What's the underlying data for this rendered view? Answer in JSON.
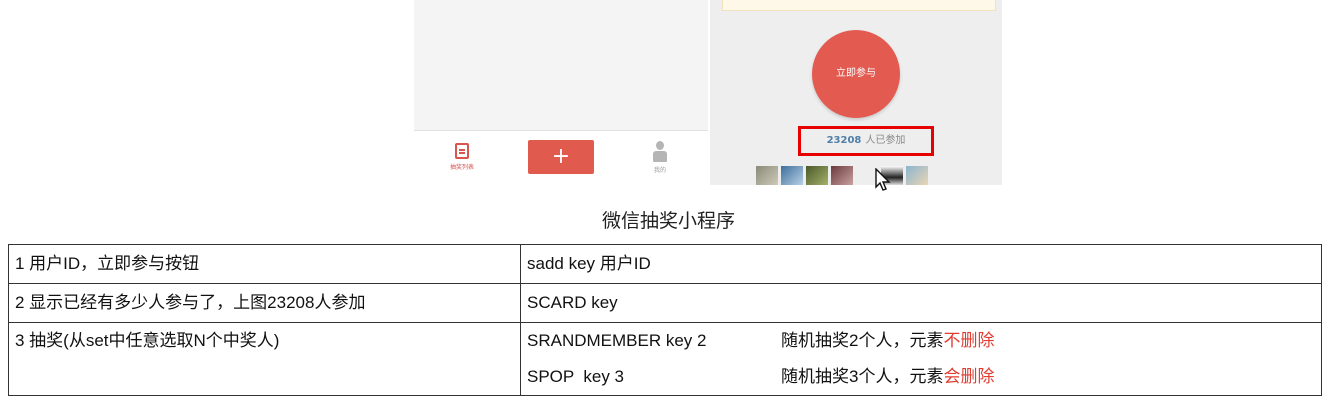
{
  "mock": {
    "left_tab_list_label": "抽奖列表",
    "add_button_label": "+",
    "me_tab_label": "我的",
    "join_button_label": "立即参与",
    "participant_count": "23208",
    "participant_suffix": "人已参加",
    "accent_color": "#e05a4e",
    "highlight_box_color": "#e60000",
    "icons": [
      "list-icon",
      "person-icon",
      "mouse-cursor-icon"
    ]
  },
  "caption": "微信抽奖小程序",
  "table": {
    "rows": [
      {
        "desc": "1 用户ID，立即参与按钮",
        "command": "sadd key 用户ID"
      },
      {
        "desc": "2 显示已经有多少人参与了，上图23208人参加",
        "command": "SCARD key"
      },
      {
        "desc": "3 抽奖(从set中任意选取N个中奖人)",
        "lines": [
          {
            "command": "SRANDMEMBER key 2",
            "note_prefix": "随机抽奖2个人，元素",
            "note_emphasis": "不删除"
          },
          {
            "command": "SPOP  key 3",
            "note_prefix": "随机抽奖3个人，元素",
            "note_emphasis": "会删除"
          }
        ]
      }
    ]
  }
}
